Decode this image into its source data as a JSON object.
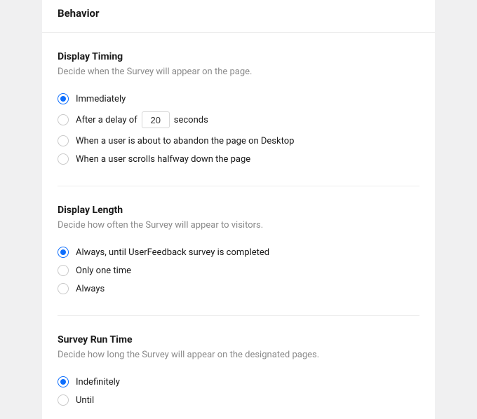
{
  "header": {
    "title": "Behavior"
  },
  "sections": {
    "timing": {
      "title": "Display Timing",
      "desc": "Decide when the Survey will appear on the page.",
      "options": {
        "immediately": "Immediately",
        "delay_prefix": "After a delay of",
        "delay_value": "20",
        "delay_suffix": "seconds",
        "abandon": "When a user is about to abandon the page on Desktop",
        "scroll": "When a user scrolls halfway down the page"
      }
    },
    "length": {
      "title": "Display Length",
      "desc": "Decide how often the Survey will appear to visitors.",
      "options": {
        "until_complete": "Always, until UserFeedback survey is completed",
        "once": "Only one time",
        "always": "Always"
      }
    },
    "runtime": {
      "title": "Survey Run Time",
      "desc": "Decide how long the Survey will appear on the designated pages.",
      "options": {
        "indefinitely": "Indefinitely",
        "until": "Until"
      }
    }
  }
}
